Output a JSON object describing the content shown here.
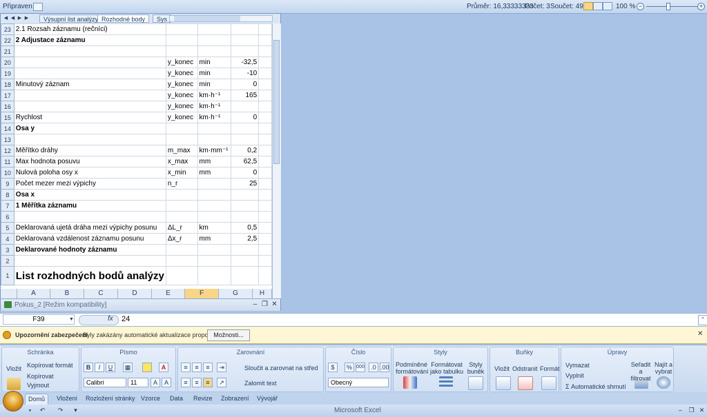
{
  "status": {
    "left_label": "Připraven",
    "average": "Průměr: 16,33333333",
    "count": "Počet: 3",
    "sum": "Součet: 49",
    "zoom": "100 %"
  },
  "sheet_tabs": [
    "Výsupní list analýzy",
    "Rozhodné body",
    "Sys"
  ],
  "rows": [
    {
      "n": "23",
      "a": "2.1 Rozsah záznamu (rečníci)",
      "e": "",
      "f": "",
      "g": ""
    },
    {
      "n": "22",
      "a": "2 Adjustace záznamu",
      "e": "",
      "f": "",
      "g": "",
      "bold": true
    },
    {
      "n": "21",
      "a": "",
      "e": "",
      "f": "",
      "g": ""
    },
    {
      "n": "20",
      "a": "",
      "e": "y_konec",
      "f": "min",
      "g": "-32,5"
    },
    {
      "n": "19",
      "a": "",
      "e": "y_konec",
      "f": "min",
      "g": "-10"
    },
    {
      "n": "18",
      "a": "Minutový záznam",
      "e": "y_konec",
      "f": "min",
      "g": "0"
    },
    {
      "n": "17",
      "a": "",
      "e": "y_konec",
      "f": "km·h⁻¹",
      "g": "165"
    },
    {
      "n": "16",
      "a": "",
      "e": "y_konec",
      "f": "km·h⁻¹",
      "g": ""
    },
    {
      "n": "15",
      "a": "Rychlost",
      "e": "y_konec",
      "f": "km·h⁻¹",
      "g": "0"
    },
    {
      "n": "14",
      "a": "Osa y",
      "e": "",
      "f": "",
      "g": "",
      "bold": true
    },
    {
      "n": "13",
      "a": "",
      "e": "",
      "f": "",
      "g": ""
    },
    {
      "n": "12",
      "a": "Měřítko dráhy",
      "e": "m_max",
      "f": "km·mm⁻¹",
      "g": "0,2"
    },
    {
      "n": "11",
      "a": "Max hodnota posuvu",
      "e": "x_max",
      "f": "mm",
      "g": "62,5"
    },
    {
      "n": "10",
      "a": "Nulová poloha osy x",
      "e": "x_min",
      "f": "mm",
      "g": "0"
    },
    {
      "n": "9",
      "a": "Počet mezer mezi výpichy",
      "e": "n_r",
      "f": "",
      "g": "25"
    },
    {
      "n": "8",
      "a": "Osa x",
      "e": "",
      "f": "",
      "g": "",
      "bold": true
    },
    {
      "n": "7",
      "a": "1 Měřítka záznamu",
      "e": "",
      "f": "",
      "g": "",
      "bold": true
    },
    {
      "n": "6",
      "a": "",
      "e": "",
      "f": "",
      "g": ""
    },
    {
      "n": "5",
      "a": "Deklarovaná ujetá dráha mezi výpichy posunu",
      "e": "ΔL_r",
      "f": "km",
      "g": "0,5"
    },
    {
      "n": "4",
      "a": "Deklarovaná vzdálenost záznamu posunu",
      "e": "Δx_r",
      "f": "mm",
      "g": "2,5"
    },
    {
      "n": "3",
      "a": "Deklarované hodnoty záznamu",
      "e": "",
      "f": "",
      "g": "",
      "bold": true
    },
    {
      "n": "2",
      "a": "",
      "e": "",
      "f": "",
      "g": ""
    },
    {
      "n": "1",
      "a": "List rozhodných bodů analýzy",
      "e": "",
      "f": "",
      "g": "",
      "big": true
    }
  ],
  "columns": [
    "A",
    "B",
    "C",
    "D",
    "E",
    "F",
    "G",
    "H"
  ],
  "workbook_title": "Pokus_2 [Režim kompatibility]",
  "formula_bar": {
    "name_box": "F39",
    "value": "24"
  },
  "security_bar": {
    "title": "Upozornění zabezpečení",
    "message": "Byly zakázány automatické aktualizace propojení.",
    "button": "Možnosti..."
  },
  "ribbon": {
    "clipboard": {
      "name": "Schránka",
      "paste": "Vložit",
      "cut": "Vyjmout",
      "copy": "Kopírovat",
      "format_painter": "Kopírovat formát"
    },
    "font": {
      "name": "Písmo",
      "family": "Calibri",
      "size": "11",
      "bold": "B",
      "italic": "I",
      "underline": "U"
    },
    "alignment": {
      "name": "Zarovnání",
      "wrap": "Zalomit text",
      "merge": "Sloučit a zarovnat na střed"
    },
    "number": {
      "name": "Číslo",
      "format": "Obecný",
      "percent": "%",
      "thousands": "000"
    },
    "styles": {
      "name": "Styly",
      "conditional": "Podmíněné formátování",
      "as_table": "Formátovat jako tabulku",
      "cell_styles": "Styly buněk"
    },
    "cells": {
      "name": "Buňky",
      "insert": "Vložit",
      "delete": "Odstranit",
      "format": "Formát"
    },
    "editing": {
      "name": "Úpravy",
      "autosum": "Automatické shrnutí",
      "fill": "Vyplnit",
      "clear": "Vymazat",
      "sort": "Seřadit a filtrovat",
      "find": "Najít a vybrat"
    }
  },
  "tabs": [
    "Domů",
    "Vložení",
    "Rozložení stránky",
    "Vzorce",
    "Data",
    "Revize",
    "Zobrazení",
    "Vývojář"
  ],
  "window_title": "Microsoft Excel"
}
